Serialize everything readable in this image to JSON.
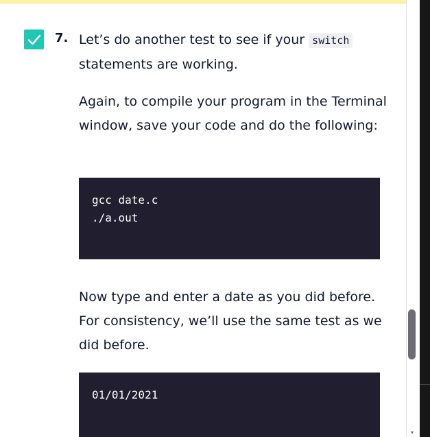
{
  "step": {
    "number": "7.",
    "completed": true,
    "checkbox_color": "#22c7b4"
  },
  "paragraphs": {
    "intro_before_code": "Let’s do another test to see if your ",
    "intro_inline_code": "switch",
    "intro_after_code": " statements are working.",
    "compile_instructions": "Again, to compile your program in the Terminal window, save your code and do the following:",
    "enter_date_instructions": "Now type and enter a date as you did before. For consistency, we’ll use the same test as we did before."
  },
  "code_blocks": {
    "compile": {
      "line_1": "gcc date.c",
      "line_2": "./a.out"
    },
    "input": {
      "line_1": "01/01/2021"
    }
  },
  "scrollbar": {
    "visible": true,
    "arrow_icon": "down-arrow-icon",
    "thumb_position_fraction": 0.72
  },
  "colors": {
    "text": "#10162f",
    "code_background": "#211f2f",
    "code_text": "#ffffff",
    "inline_code_background": "#f0f0f3",
    "accent_strip": "#fff3a6"
  },
  "icons": {
    "checkbox": "checkmark-icon"
  }
}
